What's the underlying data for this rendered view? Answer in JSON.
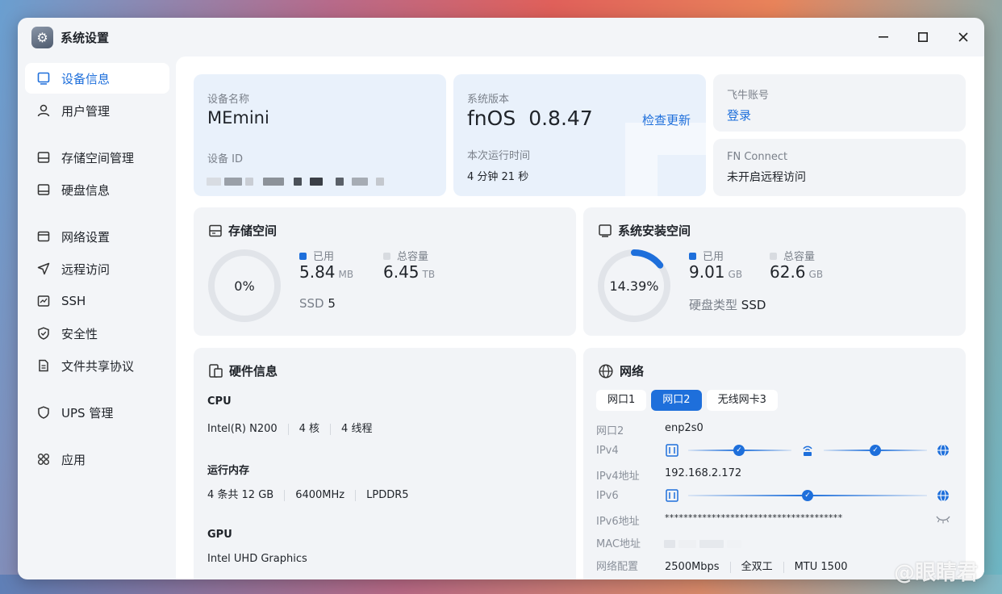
{
  "window": {
    "title": "系统设置"
  },
  "sidebar": {
    "items": [
      {
        "label": "设备信息"
      },
      {
        "label": "用户管理"
      },
      {
        "label": "存储空间管理"
      },
      {
        "label": "硬盘信息"
      },
      {
        "label": "网络设置"
      },
      {
        "label": "远程访问"
      },
      {
        "label": "SSH"
      },
      {
        "label": "安全性"
      },
      {
        "label": "文件共享协议"
      },
      {
        "label": "UPS 管理"
      },
      {
        "label": "应用"
      }
    ]
  },
  "device": {
    "name_label": "设备名称",
    "name": "MEmini",
    "id_label": "设备 ID"
  },
  "system": {
    "version_label": "系统版本",
    "os": "fnOS",
    "version": "0.8.47",
    "check_update": "检查更新",
    "uptime_label": "本次运行时间",
    "uptime": "4 分钟 21 秒"
  },
  "account": {
    "label": "飞牛账号",
    "login": "登录"
  },
  "fnconnect": {
    "label": "FN Connect",
    "status": "未开启远程访问"
  },
  "storage": {
    "title": "存储空间",
    "percent_text": "0%",
    "percent": 0,
    "used_label": "已用",
    "used_value": "5.84",
    "used_unit": "MB",
    "total_label": "总容量",
    "total_value": "6.45",
    "total_unit": "TB",
    "type_label": "SSD",
    "type_value": "5"
  },
  "sysinstall": {
    "title": "系统安装空间",
    "percent_text": "14.39%",
    "percent": 14.39,
    "used_label": "已用",
    "used_value": "9.01",
    "used_unit": "GB",
    "total_label": "总容量",
    "total_value": "62.6",
    "total_unit": "GB",
    "disk_type_label": "硬盘类型",
    "disk_type_value": "SSD"
  },
  "hardware": {
    "title": "硬件信息",
    "cpu_label": "CPU",
    "cpu_model": "Intel(R) N200",
    "cpu_cores": "4 核",
    "cpu_threads": "4 线程",
    "mem_label": "运行内存",
    "mem_size": "4 条共 12 GB",
    "mem_freq": "6400MHz",
    "mem_type": "LPDDR5",
    "gpu_label": "GPU",
    "gpu_model": "Intel UHD Graphics"
  },
  "network": {
    "title": "网络",
    "tabs": [
      {
        "label": "网口1"
      },
      {
        "label": "网口2"
      },
      {
        "label": "无线网卡3"
      }
    ],
    "iface_label": "网口2",
    "iface_value": "enp2s0",
    "ipv4_label": "IPv4",
    "ipv4_addr_label": "IPv4地址",
    "ipv4_addr": "192.168.2.172",
    "ipv6_label": "IPv6",
    "ipv6_addr_label": "IPv6地址",
    "ipv6_addr": "**************************************",
    "mac_label": "MAC地址",
    "config_label": "网络配置",
    "speed": "2500Mbps",
    "duplex": "全双工",
    "mtu": "MTU 1500"
  },
  "colors": {
    "accent": "#1e6fdb",
    "track": "#e3e6eb"
  },
  "watermark": "@眼睛君"
}
